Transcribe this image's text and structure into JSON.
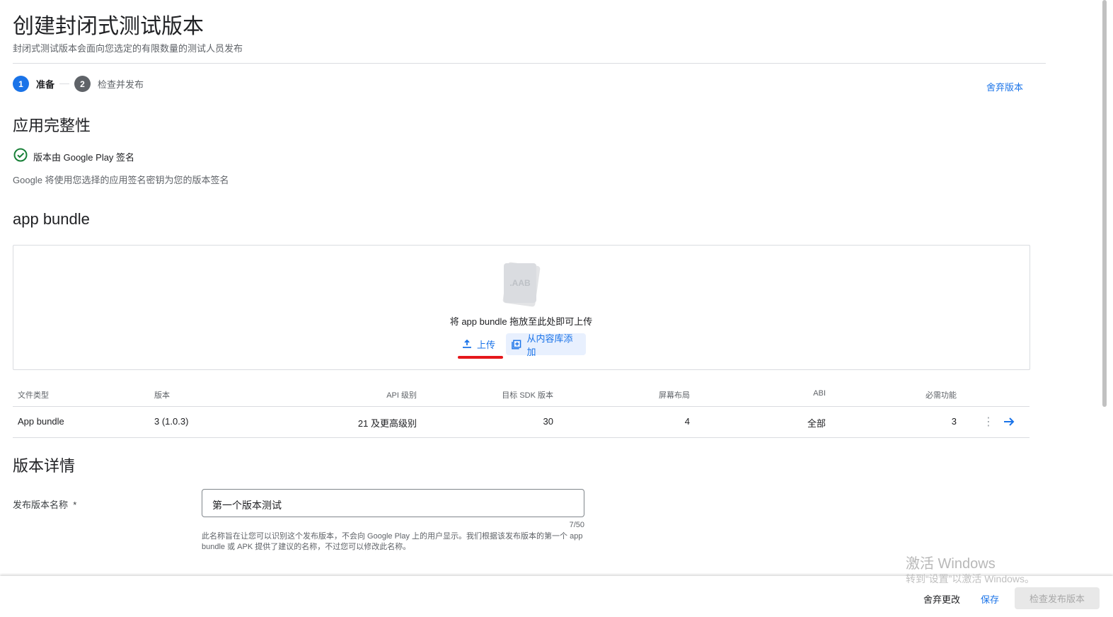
{
  "header": {
    "title": "创建封闭式测试版本",
    "subtitle": "封闭式测试版本会面向您选定的有限数量的测试人员发布",
    "discard_release": "舍弃版本"
  },
  "steps": [
    {
      "num": "1",
      "label": "准备",
      "active": true
    },
    {
      "num": "2",
      "label": "检查并发布",
      "active": false
    }
  ],
  "integrity": {
    "heading": "应用完整性",
    "status": "版本由 Google Play 签名",
    "description": "Google 将使用您选择的应用签名密钥为您的版本签名"
  },
  "bundle": {
    "heading": "app bundle",
    "file_icon_label": ".AAB",
    "drop_hint": "将 app bundle 拖放至此处即可上传",
    "upload": "上传",
    "add_from_library": "从内容库添加"
  },
  "table": {
    "headers": [
      "文件类型",
      "版本",
      "API 级别",
      "目标 SDK 版本",
      "屏幕布局",
      "ABI",
      "必需功能"
    ],
    "rows": [
      [
        "App bundle",
        "3 (1.0.3)",
        "21 及更高级别",
        "30",
        "4",
        "全部",
        "3"
      ]
    ]
  },
  "details": {
    "heading": "版本详情",
    "name_label": "发布版本名称",
    "required_mark": "*",
    "name_value": "第一个版本测试",
    "counter": "7/50",
    "help": "此名称旨在让您可以识别这个发布版本，不会向 Google Play 上的用户显示。我们根据该发布版本的第一个 app bundle 或 APK 提供了建议的名称，不过您可以修改此名称。"
  },
  "footer": {
    "discard_changes": "舍弃更改",
    "save": "保存",
    "review": "检查发布版本"
  },
  "watermark": {
    "line1": "激活 Windows",
    "line2": "转到“设置”以激活 Windows。"
  },
  "colors": {
    "accent": "#1a73e8",
    "success": "#188038"
  }
}
